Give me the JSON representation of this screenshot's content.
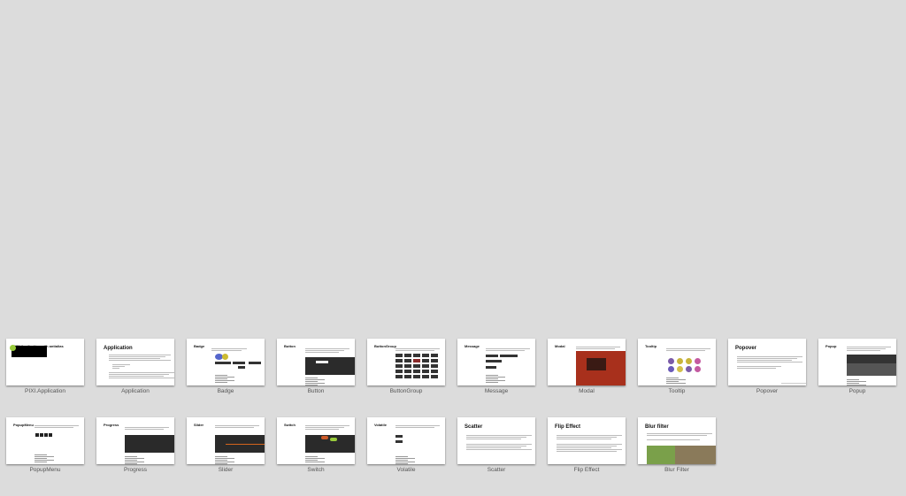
{
  "slides": [
    {
      "label": "PIXI.Application",
      "title": "PIXI.Application with antialias",
      "kind": "app"
    },
    {
      "label": "Application",
      "title": "Application",
      "kind": "text"
    },
    {
      "label": "Badge",
      "title": "Badge",
      "kind": "badge"
    },
    {
      "label": "Button",
      "title": "Button",
      "kind": "button"
    },
    {
      "label": "ButtonGroup",
      "title": "ButtonGroup",
      "kind": "buttongroup"
    },
    {
      "label": "Message",
      "title": "Message",
      "kind": "message"
    },
    {
      "label": "Modal",
      "title": "Modal",
      "kind": "modal"
    },
    {
      "label": "Tooltip",
      "title": "Tooltip",
      "kind": "tooltip"
    },
    {
      "label": "Popover",
      "title": "Popover",
      "kind": "popover"
    },
    {
      "label": "Popup",
      "title": "Popup",
      "kind": "popup"
    },
    {
      "label": "PopupMenu",
      "title": "PopupMenu",
      "kind": "popupmenu"
    },
    {
      "label": "Progress",
      "title": "Progress",
      "kind": "progress"
    },
    {
      "label": "Slider",
      "title": "Slider",
      "kind": "slider"
    },
    {
      "label": "Switch",
      "title": "Switch",
      "kind": "switch"
    },
    {
      "label": "Volatile",
      "title": "Volatile",
      "kind": "volatile"
    },
    {
      "label": "Scatter",
      "title": "Scatter",
      "kind": "scatter"
    },
    {
      "label": "Flip Effect",
      "title": "Flip Effect",
      "kind": "flip"
    },
    {
      "label": "Blur Filter",
      "title": "Blur filter",
      "kind": "blur"
    }
  ],
  "colors": {
    "background": "#dcdcdc",
    "modal": "#a8301c",
    "slider": "#d6641c",
    "tooltip_purple": "#7b5ba8",
    "tooltip_yellow": "#c8b43a",
    "tooltip_pink": "#c45aa0",
    "green": "#9acc3c"
  }
}
